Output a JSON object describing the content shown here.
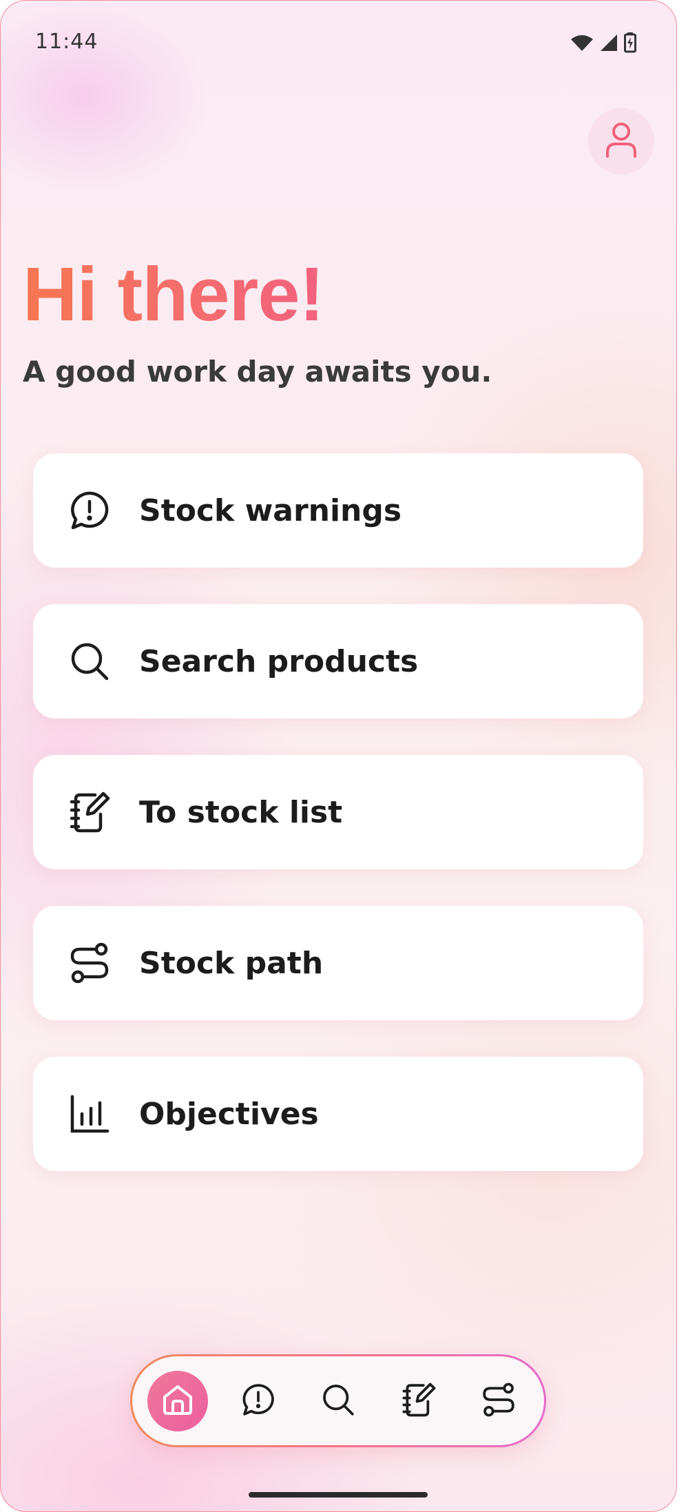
{
  "status_bar": {
    "time": "11:44",
    "icons": [
      "wifi-icon",
      "signal-icon",
      "battery-icon"
    ]
  },
  "header": {
    "greeting": "Hi there!",
    "subtitle": "A good work day awaits you.",
    "profile_icon": "user-icon"
  },
  "menu": {
    "items": [
      {
        "label": "Stock warnings",
        "icon": "alert-chat-icon"
      },
      {
        "label": "Search products",
        "icon": "search-icon"
      },
      {
        "label": "To stock list",
        "icon": "notebook-edit-icon"
      },
      {
        "label": "Stock path",
        "icon": "route-icon"
      },
      {
        "label": "Objectives",
        "icon": "bar-chart-icon"
      }
    ]
  },
  "bottom_nav": {
    "items": [
      {
        "icon": "home-icon",
        "active": true
      },
      {
        "icon": "alert-chat-icon",
        "active": false
      },
      {
        "icon": "search-icon",
        "active": false
      },
      {
        "icon": "notebook-edit-icon",
        "active": false
      },
      {
        "icon": "route-icon",
        "active": false
      }
    ]
  },
  "colors": {
    "accent": "#f46d6d",
    "accent_pink": "#ec5f9e",
    "text_dark": "#1c1c1c"
  }
}
